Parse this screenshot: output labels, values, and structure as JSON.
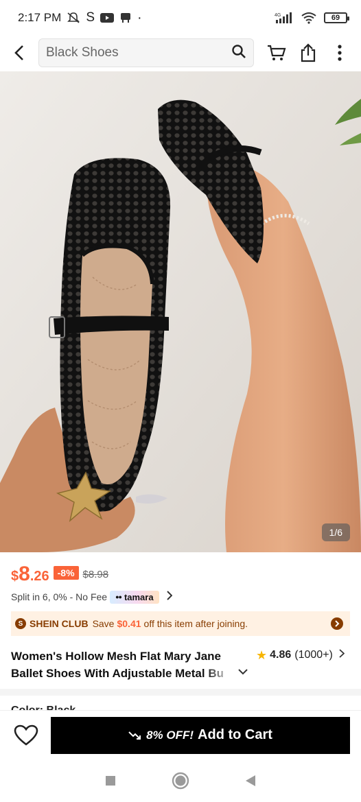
{
  "status_bar": {
    "time": "2:17 PM",
    "carrier_s": "S",
    "network": "4G",
    "battery": "69"
  },
  "search": {
    "value": "Black Shoes"
  },
  "hero": {
    "page_indicator": "1/6"
  },
  "price": {
    "currency": "$",
    "integer": "8",
    "decimal": ".26",
    "discount": "-8%",
    "original": "$8.98"
  },
  "installments": {
    "text": "Split in 6, 0% - No Fee",
    "provider": "tamara"
  },
  "club": {
    "name": "SHEIN CLUB",
    "save_prefix": "Save",
    "save_amount": "$0.41",
    "save_suffix": "off this item after joining."
  },
  "product": {
    "title": "Women's Hollow Mesh Flat Mary Jane Ballet Shoes With Adjustable Metal Bu",
    "rating": "4.86",
    "review_count": "(1000+)"
  },
  "color_section": {
    "label": "Color: Black"
  },
  "action_bar": {
    "promo": "8% OFF!",
    "add_to_cart": "Add to Cart"
  },
  "colors": {
    "accent": "#fa6338",
    "club_brown": "#873c00",
    "club_bg": "#fff1e3",
    "cart_button": "#000000",
    "star": "#f7b500"
  }
}
